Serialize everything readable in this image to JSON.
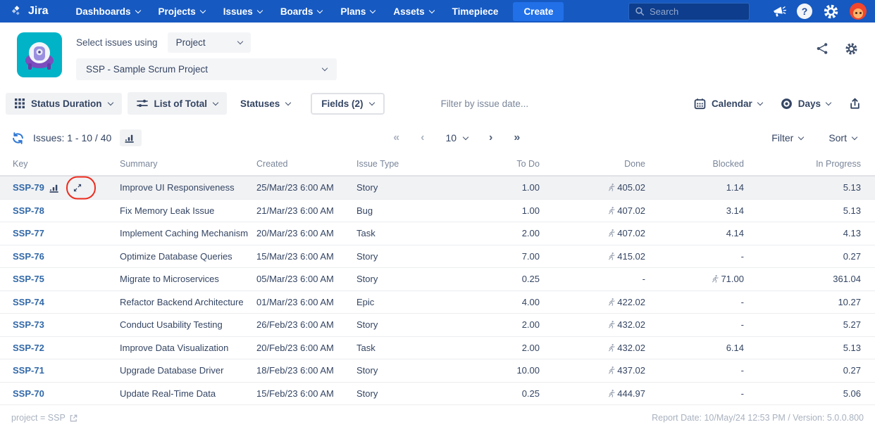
{
  "navbar": {
    "brand": "Jira",
    "items": [
      {
        "label": "Dashboards"
      },
      {
        "label": "Projects"
      },
      {
        "label": "Issues"
      },
      {
        "label": "Boards"
      },
      {
        "label": "Plans"
      },
      {
        "label": "Assets"
      },
      {
        "label": "Timepiece"
      }
    ],
    "create_label": "Create",
    "search_placeholder": "Search"
  },
  "header": {
    "select_issues_label": "Select issues using",
    "issue_source_value": "Project",
    "project_value": "SSP - Sample Scrum Project"
  },
  "toolbar": {
    "report_type_label": "Status Duration",
    "view_mode_label": "List of Total",
    "statuses_label": "Statuses",
    "fields_label": "Fields (2)",
    "date_filter_placeholder": "Filter by issue date...",
    "calendar_label": "Calendar",
    "time_unit_label": "Days"
  },
  "listbar": {
    "issues_range": "Issues: 1 - 10 / 40",
    "first_page": "«",
    "prev_page": "‹",
    "page_size": "10",
    "next_page": "›",
    "last_page": "»",
    "filter_label": "Filter",
    "sort_label": "Sort"
  },
  "table": {
    "headers": {
      "key": "Key",
      "summary": "Summary",
      "created": "Created",
      "issue_type": "Issue Type",
      "todo": "To Do",
      "done": "Done",
      "blocked": "Blocked",
      "in_progress": "In Progress"
    },
    "rows": [
      {
        "key": "SSP-79",
        "summary": "Improve UI Responsiveness",
        "created": "25/Mar/23 6:00 AM",
        "issue_type": "Story",
        "todo": "1.00",
        "done": "405.02",
        "done_runner": true,
        "blocked": "1.14",
        "blocked_runner": false,
        "in_progress": "5.13",
        "highlight": true,
        "show_icons": true,
        "annotated": true
      },
      {
        "key": "SSP-78",
        "summary": "Fix Memory Leak Issue",
        "created": "21/Mar/23 6:00 AM",
        "issue_type": "Bug",
        "todo": "1.00",
        "done": "407.02",
        "done_runner": true,
        "blocked": "3.14",
        "blocked_runner": false,
        "in_progress": "5.13"
      },
      {
        "key": "SSP-77",
        "summary": "Implement Caching Mechanism",
        "created": "20/Mar/23 6:00 AM",
        "issue_type": "Task",
        "todo": "2.00",
        "done": "407.02",
        "done_runner": true,
        "blocked": "4.14",
        "blocked_runner": false,
        "in_progress": "4.13"
      },
      {
        "key": "SSP-76",
        "summary": "Optimize Database Queries",
        "created": "15/Mar/23 6:00 AM",
        "issue_type": "Story",
        "todo": "7.00",
        "done": "415.02",
        "done_runner": true,
        "blocked": "-",
        "blocked_runner": false,
        "in_progress": "0.27"
      },
      {
        "key": "SSP-75",
        "summary": "Migrate to Microservices",
        "created": "05/Mar/23 6:00 AM",
        "issue_type": "Story",
        "todo": "0.25",
        "done": "-",
        "done_runner": false,
        "blocked": "71.00",
        "blocked_runner": true,
        "in_progress": "361.04"
      },
      {
        "key": "SSP-74",
        "summary": "Refactor Backend Architecture",
        "created": "01/Mar/23 6:00 AM",
        "issue_type": "Epic",
        "todo": "4.00",
        "done": "422.02",
        "done_runner": true,
        "blocked": "-",
        "blocked_runner": false,
        "in_progress": "10.27"
      },
      {
        "key": "SSP-73",
        "summary": "Conduct Usability Testing",
        "created": "26/Feb/23 6:00 AM",
        "issue_type": "Story",
        "todo": "2.00",
        "done": "432.02",
        "done_runner": true,
        "blocked": "-",
        "blocked_runner": false,
        "in_progress": "5.27"
      },
      {
        "key": "SSP-72",
        "summary": "Improve Data Visualization",
        "created": "20/Feb/23 6:00 AM",
        "issue_type": "Task",
        "todo": "2.00",
        "done": "432.02",
        "done_runner": true,
        "blocked": "6.14",
        "blocked_runner": false,
        "in_progress": "5.13"
      },
      {
        "key": "SSP-71",
        "summary": "Upgrade Database Driver",
        "created": "18/Feb/23 6:00 AM",
        "issue_type": "Story",
        "todo": "10.00",
        "done": "437.02",
        "done_runner": true,
        "blocked": "-",
        "blocked_runner": false,
        "in_progress": "0.27"
      },
      {
        "key": "SSP-70",
        "summary": "Update Real-Time Data",
        "created": "15/Feb/23 6:00 AM",
        "issue_type": "Story",
        "todo": "0.25",
        "done": "444.97",
        "done_runner": true,
        "blocked": "-",
        "blocked_runner": false,
        "in_progress": "5.06"
      }
    ]
  },
  "footer": {
    "jql_text": "project = SSP",
    "report_meta": "Report Date: 10/May/24 12:53 PM / Version: 5.0.0.800"
  },
  "colors": {
    "navbar_bg": "#1659c1",
    "create_button": "#2170e8",
    "issue_link": "#3168a8",
    "annotation_red": "#ed2c1e",
    "app_icon_teal": "#00b3c7",
    "accent_blue": "#2f77d4"
  }
}
